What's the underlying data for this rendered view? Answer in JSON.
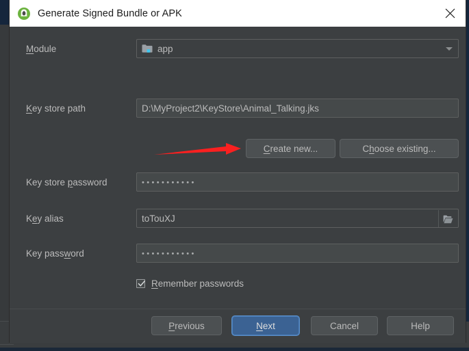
{
  "window": {
    "title": "Generate Signed Bundle or APK",
    "app_icon": "android-studio-icon",
    "close_icon": "close-icon"
  },
  "form": {
    "module": {
      "label_pre": "M",
      "label_post": "odule",
      "value": "app",
      "folder_icon": "module-folder-icon",
      "dropdown_icon": "chevron-down-icon"
    },
    "key_store_path": {
      "label_pre": "K",
      "label_post": "ey store path",
      "value": "D:\\MyProject2\\KeyStore\\Animal_Talking.jks"
    },
    "create_new_button": {
      "label_pre": "C",
      "label_post": "reate new..."
    },
    "choose_existing_button": {
      "label_pre": "C",
      "label_mid": "h",
      "label_post": "oose existing..."
    },
    "key_store_password": {
      "label_pre": "Key store ",
      "label_mn": "p",
      "label_post": "assword",
      "value": "•••••••••••"
    },
    "key_alias": {
      "label_pre": "K",
      "label_mn": "e",
      "label_post": "y alias",
      "value": "toTouXJ",
      "browse_icon": "folder-open-icon"
    },
    "key_password": {
      "label_pre": "Key pass",
      "label_mn": "w",
      "label_post": "ord",
      "value": "•••••••••••"
    },
    "remember_passwords": {
      "label_pre": "R",
      "label_post": "emember passwords",
      "checked": true,
      "check_icon": "checkmark-icon"
    }
  },
  "footer": {
    "previous": {
      "label_pre": "P",
      "label_post": "revious"
    },
    "next": {
      "label_pre": "N",
      "label_post": "ext"
    },
    "cancel": {
      "label": "Cancel"
    },
    "help": {
      "label": "Help"
    }
  },
  "annotation": {
    "arrow_icon": "red-arrow-icon",
    "arrow_color": "#fa2020",
    "points_to": "create_new_button"
  },
  "colors": {
    "dialog_bg": "#3c3f41",
    "field_bg": "#45494a",
    "text": "#bbbbbb",
    "titlebar_bg": "#ffffff",
    "primary_button": "#3b6293",
    "accent_focus": "#5a8fc9",
    "backdrop_navy": "#15263c"
  }
}
